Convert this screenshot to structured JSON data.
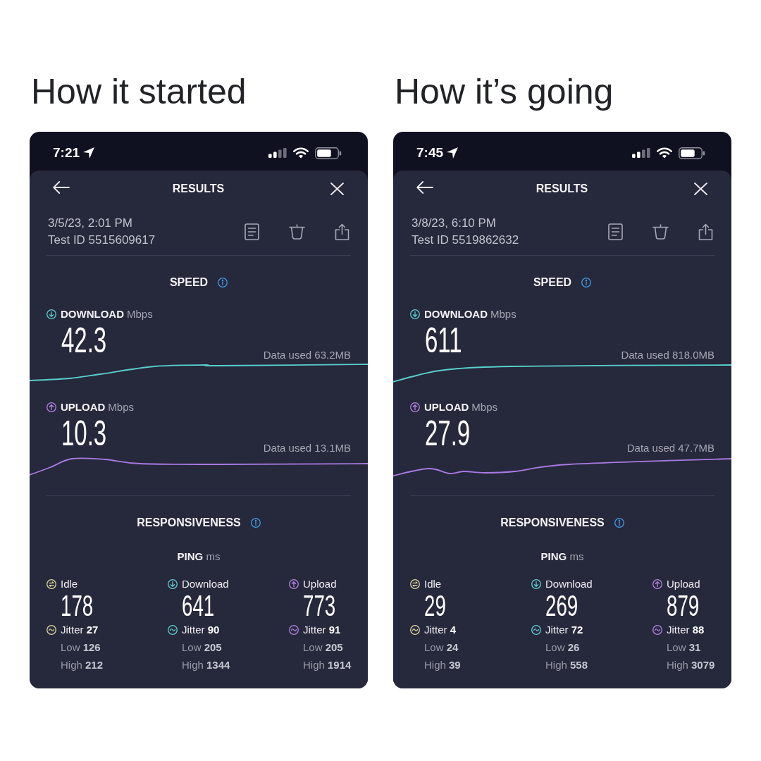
{
  "panels": [
    {
      "caption": "How it started",
      "status_bar": {
        "time": "7:21"
      },
      "header": {
        "title": "RESULTS"
      },
      "test": {
        "date": "3/5/23, 2:01 PM",
        "id": "Test ID 5515609617"
      },
      "speed": {
        "title": "SPEED",
        "metrics": [
          {
            "kind": "download",
            "label": "DOWNLOAD",
            "unit": "Mbps",
            "value": "42.3",
            "data_used": "Data used 63.2MB"
          },
          {
            "kind": "upload",
            "label": "UPLOAD",
            "unit": "Mbps",
            "value": "10.3",
            "data_used": "Data used 13.1MB"
          }
        ]
      },
      "responsiveness": {
        "title": "RESPONSIVENESS",
        "ping": "**PING** ms",
        "columns": [
          {
            "kind": "idle",
            "label": "Idle",
            "value": "178",
            "jitter": "Jitter **27**",
            "low": "Low **126**",
            "high": "High **212**"
          },
          {
            "kind": "download",
            "label": "Download",
            "value": "641",
            "jitter": "Jitter **90**",
            "low": "Low **205**",
            "high": "High **1344**"
          },
          {
            "kind": "upload",
            "label": "Upload",
            "value": "773",
            "jitter": "Jitter **91**",
            "low": "Low **205**",
            "high": "High **1914**"
          }
        ]
      }
    },
    {
      "caption": "How it’s going",
      "status_bar": {
        "time": "7:45"
      },
      "header": {
        "title": "RESULTS"
      },
      "test": {
        "date": "3/8/23, 6:10 PM",
        "id": "Test ID 5519862632"
      },
      "speed": {
        "title": "SPEED",
        "metrics": [
          {
            "kind": "download",
            "label": "DOWNLOAD",
            "unit": "Mbps",
            "value": "611",
            "data_used": "Data used 818.0MB"
          },
          {
            "kind": "upload",
            "label": "UPLOAD",
            "unit": "Mbps",
            "value": "27.9",
            "data_used": "Data used 47.7MB"
          }
        ]
      },
      "responsiveness": {
        "title": "RESPONSIVENESS",
        "ping": "**PING** ms",
        "columns": [
          {
            "kind": "idle",
            "label": "Idle",
            "value": "29",
            "jitter": "Jitter **4**",
            "low": "Low **24**",
            "high": "High **39**"
          },
          {
            "kind": "download",
            "label": "Download",
            "value": "269",
            "jitter": "Jitter **72**",
            "low": "Low **26**",
            "high": "High **558**"
          },
          {
            "kind": "upload",
            "label": "Upload",
            "value": "879",
            "jitter": "Jitter **88**",
            "low": "Low **31**",
            "high": "High **3079**"
          }
        ]
      }
    }
  ]
}
